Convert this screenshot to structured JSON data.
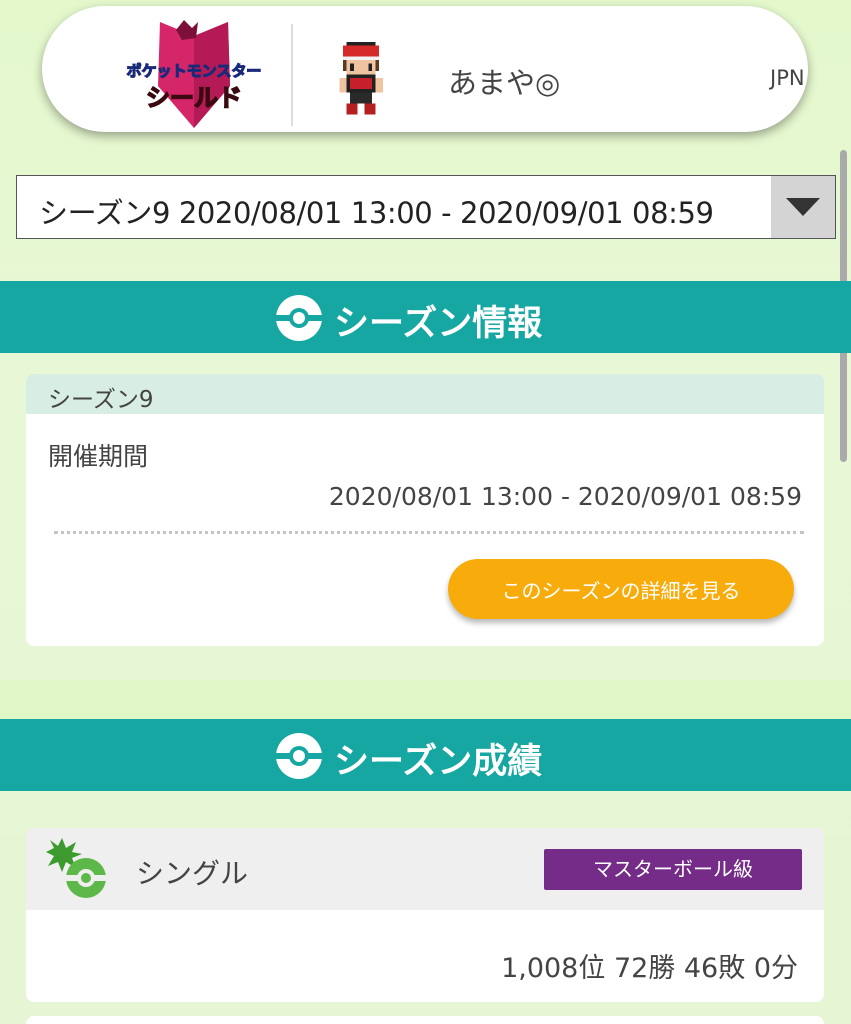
{
  "profile": {
    "logo_line1": "ポケットモンスター",
    "logo_line2": "シールド",
    "name": "あまや◎",
    "region": "JPN"
  },
  "season_selector": {
    "selected": "シーズン9 2020/08/01 13:00 - 2020/09/01 08:59"
  },
  "season_info": {
    "heading": "シーズン情報",
    "season_name": "シーズン9",
    "period_label": "開催期間",
    "period_value": "2020/08/01 13:00 - 2020/09/01 08:59",
    "detail_button": "このシーズンの詳細を見る"
  },
  "season_results": {
    "heading": "シーズン成績",
    "battle_type": "シングル",
    "rank_badge": "マスターボール級",
    "record": "1,008位 72勝 46敗 0分"
  },
  "colors": {
    "header_teal": "#16a7a2",
    "button_orange": "#f8ac0c",
    "badge_purple": "#742c88"
  }
}
